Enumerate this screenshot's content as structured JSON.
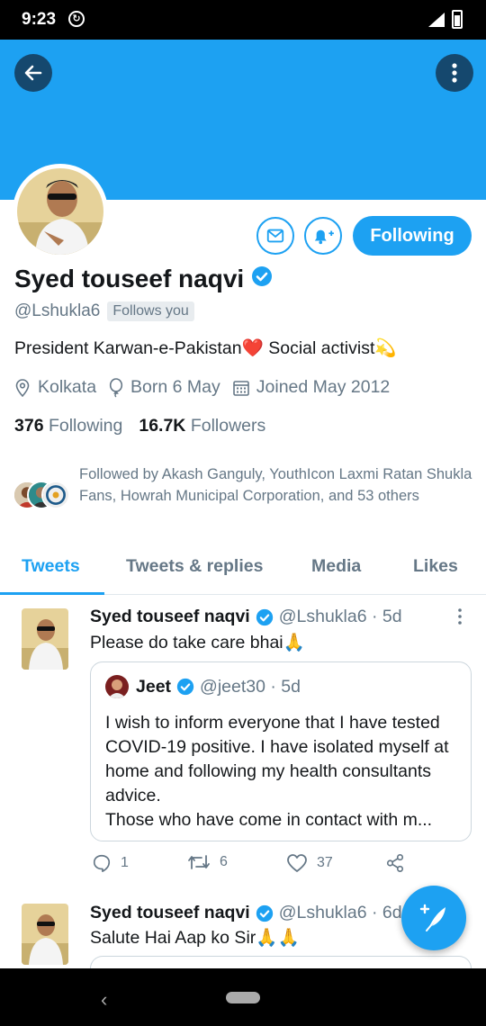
{
  "status_bar": {
    "time": "9:23",
    "sync_icon": "sync-icon"
  },
  "header": {
    "back_icon": "arrow-left-icon",
    "more_icon": "more-vertical-icon"
  },
  "actions": {
    "follow_label": "Following",
    "message_icon": "mail-icon",
    "notify_icon": "bell-plus-icon"
  },
  "profile": {
    "name": "Syed touseef naqvi",
    "handle": "@Lshukla6",
    "follows_you": "Follows you",
    "bio": "President Karwan-e-Pakistan❤️ Social activist💫",
    "location": "Kolkata",
    "birthday": "Born 6 May",
    "joined": "Joined May 2012",
    "following_count": "376",
    "following_label": "Following",
    "followers_count": "16.7K",
    "followers_label": "Followers",
    "followed_by": "Followed by Akash Ganguly, YouthIcon Laxmi Ratan Shukla Fans, Howrah Municipal Corporation, and 53 others"
  },
  "tabs": [
    {
      "label": "Tweets",
      "active": true
    },
    {
      "label": "Tweets & replies",
      "active": false
    },
    {
      "label": "Media",
      "active": false
    },
    {
      "label": "Likes",
      "active": false
    }
  ],
  "tweets": [
    {
      "name": "Syed touseef naqvi",
      "meta": "@Lshukla6 · 5d",
      "text": "Please do take care bhai🙏",
      "quote": {
        "name": "Jeet",
        "meta": "@jeet30 · 5d",
        "text": "I wish to inform everyone that I have tested COVID-19 positive. I have isolated myself at home and following my health consultants advice.\nThose who have come in contact with m..."
      },
      "replies": "1",
      "retweets": "6",
      "likes": "37"
    },
    {
      "name": "Syed touseef naqvi",
      "meta": "@Lshukla6 · 6d",
      "text": "Salute Hai Aap ko Sir🙏🙏"
    }
  ],
  "colors": {
    "accent": "#1da1f2",
    "text": "#14171a",
    "muted": "#657786",
    "banner": "#1da1f2"
  }
}
